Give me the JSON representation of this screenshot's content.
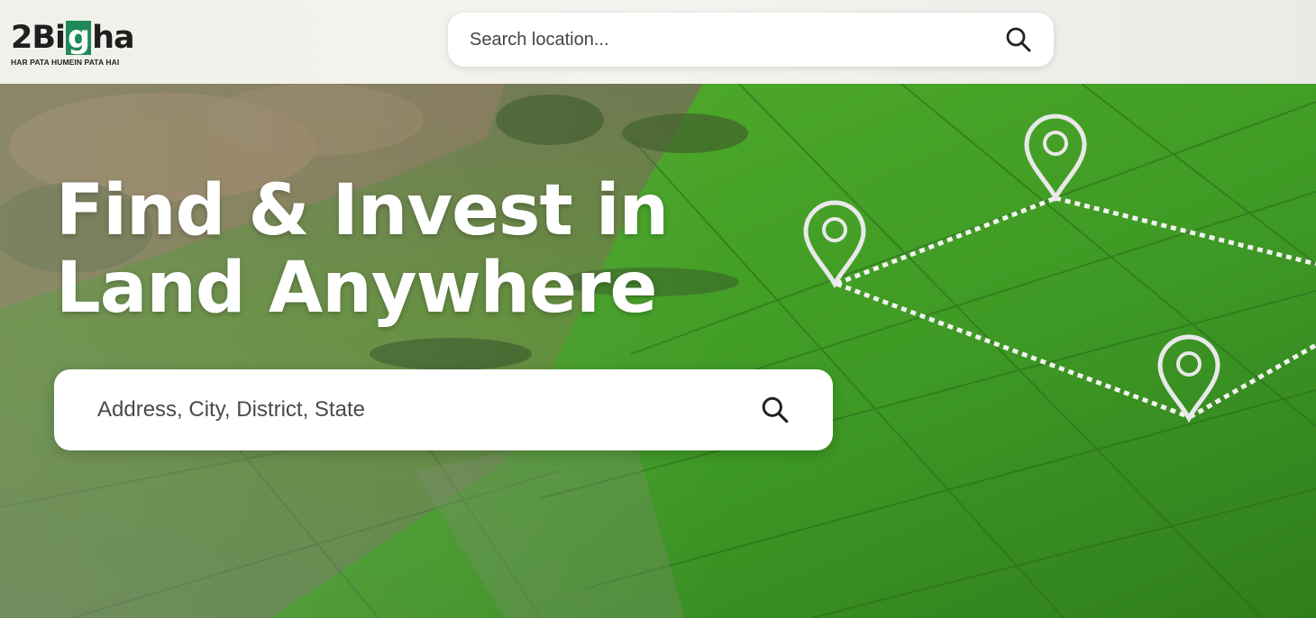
{
  "logo": {
    "prefix": "2Bi",
    "highlight": "g",
    "suffix": "ha",
    "tagline": "HAR PATA HUMEIN PATA HAI",
    "brand_color": "#1f8a57"
  },
  "header_search": {
    "placeholder": "Search location...",
    "icon": "search-icon"
  },
  "hero": {
    "headline_line1": "Find & Invest in",
    "headline_line2": "Land Anywhere",
    "background": "aerial view of green farmland plots",
    "markers_icon": "location-pin-icon"
  },
  "main_search": {
    "placeholder": "Address, City, District, State",
    "icon": "search-icon"
  },
  "colors": {
    "field_green": "#4fa52a",
    "headline": "#ffffff",
    "pin": "#e9e9e9"
  }
}
